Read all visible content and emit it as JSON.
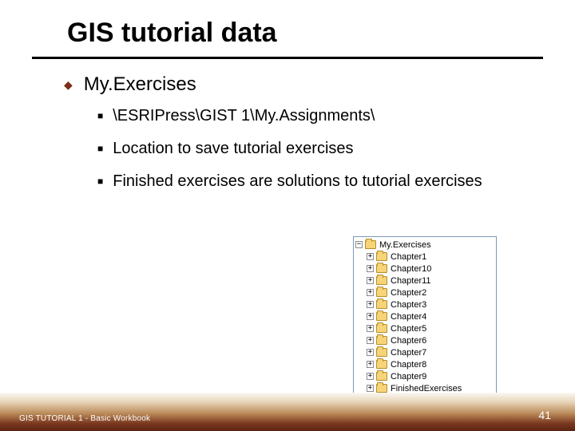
{
  "title": "GIS tutorial data",
  "bullets": {
    "lvl1_1": "My.Exercises",
    "lvl2_1": "\\ESRIPress\\GIST 1\\My.Assignments\\",
    "lvl2_2": "Location to save tutorial exercises",
    "lvl2_3": "Finished exercises are solutions to tutorial exercises"
  },
  "symbols": {
    "diamond": "◆",
    "square": "■",
    "minus": "−",
    "plus": "+"
  },
  "tree": {
    "root": "My.Exercises",
    "children": [
      "Chapter1",
      "Chapter10",
      "Chapter11",
      "Chapter2",
      "Chapter3",
      "Chapter4",
      "Chapter5",
      "Chapter6",
      "Chapter7",
      "Chapter8",
      "Chapter9",
      "FinishedExercises"
    ]
  },
  "footer": {
    "left": "GIS TUTORIAL 1 - Basic Workbook",
    "page": "41"
  }
}
